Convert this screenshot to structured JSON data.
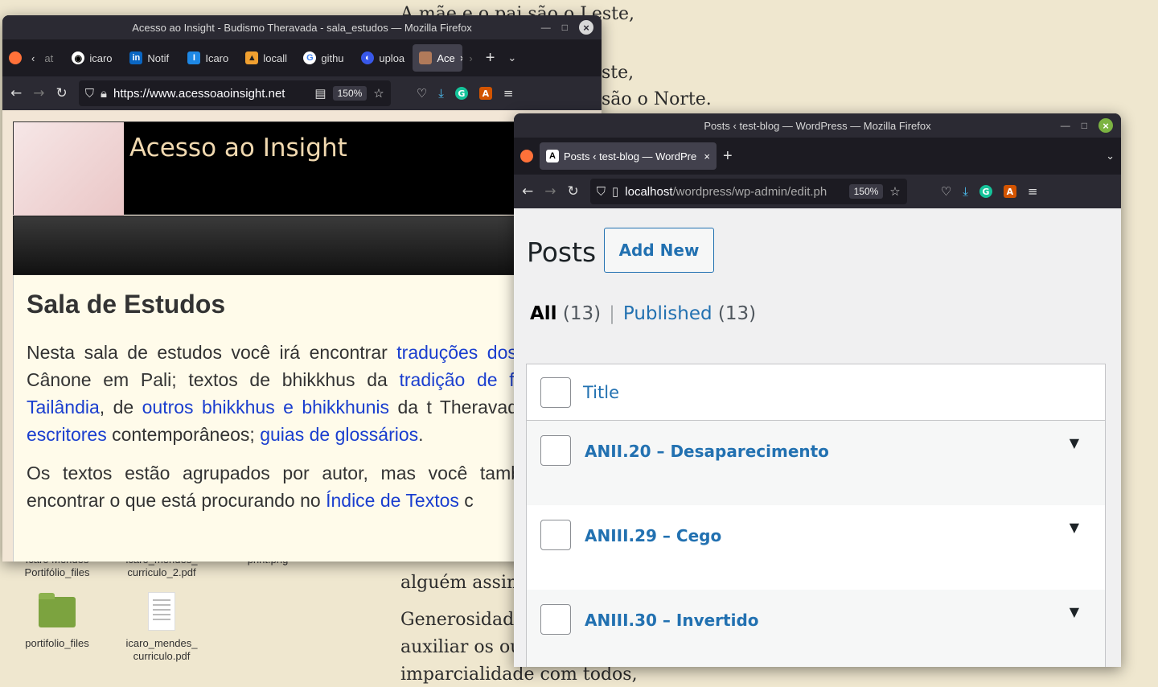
{
  "desktop": {
    "bg_lines": [
      "A mãe e o pai são o Leste,",
      "ste,",
      "são o Norte.",
      "alguém assim",
      "Generosidade",
      "auxiliar os ou",
      "imparcialidade com todos,"
    ],
    "icons": [
      {
        "label": "Icaro Mendes Portifólio_files"
      },
      {
        "label": "icaro_mendes_ curriculo_2.pdf"
      },
      {
        "label": "print.png"
      },
      {
        "label": "portifolio_files"
      },
      {
        "label": "icaro_mendes_ curriculo.pdf"
      }
    ]
  },
  "win1": {
    "title": "Acesso ao Insight - Budismo Theravada - sala_estudos — Mozilla Firefox",
    "tabs": [
      "at",
      "icaro",
      "Notif",
      "Icaro",
      "locall",
      "githu",
      "uploa",
      "Ace"
    ],
    "url": "https://www.acessoaoinsight.net",
    "zoom": "150%",
    "site_title": "Acesso ao Insight",
    "heading": "Sala de Estudos",
    "p1": {
      "t1": "Nesta sala de estudos você irá encontrar ",
      "l1": "traduções dos",
      "t2": " do Cânone em Pali; textos de bhikkhus da ",
      "l2": "tradição de f",
      "l3": "da Tailândia",
      "t3": ", de ",
      "l4": "outros bhikkhus e bhikkhunis",
      "t4": " da t Theravada e ",
      "l5": "escritores",
      "t5": " contemporâneos; ",
      "l6": "guias de",
      "l7": "glossários",
      "t6": "."
    },
    "p2": {
      "t1": "Os textos estão agrupados por autor, mas você também encontrar o que está procurando no ",
      "l1": "Índice de Textos",
      "t2": " c"
    }
  },
  "win2": {
    "title": "Posts ‹ test-blog — WordPress — Mozilla Firefox",
    "tab": "Posts ‹ test-blog — WordPre",
    "url_main": "localhost",
    "url_rest": "/wordpress/wp-admin/edit.ph",
    "zoom": "150%",
    "heading": "Posts",
    "add_new": "Add New",
    "filter_all": "All",
    "filter_all_count": "(13)",
    "filter_sep": "|",
    "filter_published": "Published",
    "filter_published_count": "(13)",
    "col_title": "Title",
    "posts": [
      {
        "title": "ANII.20 – Desaparecimento"
      },
      {
        "title": "ANIII.29 – Cego"
      },
      {
        "title": "ANIII.30 – Invertido"
      }
    ]
  }
}
